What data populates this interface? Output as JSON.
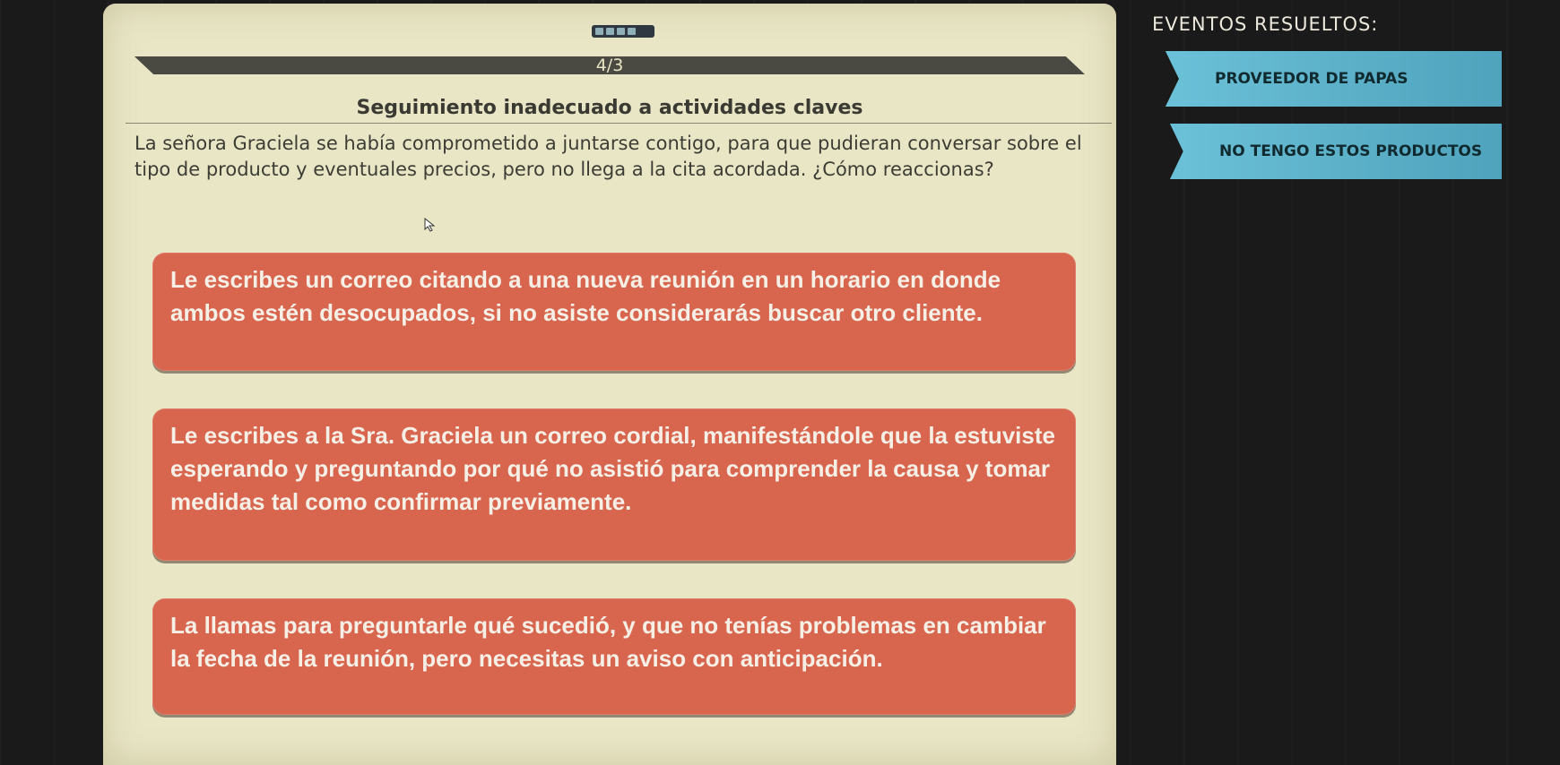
{
  "game": {
    "counter": "4/3",
    "title": "Seguimiento inadecuado a actividades claves",
    "scenario": "La señora Graciela se había comprometido a juntarse contigo, para que pudieran conversar sobre el tipo de producto y eventuales precios, pero no llega a la cita acordada. ¿Cómo reaccionas?",
    "options": [
      {
        "label": "Le escribes un correo citando a una nueva reunión en un horario en donde ambos estén desocupados, si no asiste considerarás buscar otro cliente."
      },
      {
        "label": "Le escribes a la Sra. Graciela un correo cordial, manifestándole que la estuviste esperando y preguntando por qué no asistió para comprender la causa y tomar medidas tal como confirmar previamente."
      },
      {
        "label": "La llamas para preguntarle qué sucedió, y que no tenías problemas en cambiar la fecha de la reunión, pero necesitas un aviso con anticipación."
      }
    ],
    "progress_icon": "progress-dots-icon",
    "cursor_icon": "mouse-pointer-icon"
  },
  "sidebar": {
    "title": "EVENTOS RESUELTOS:",
    "events": [
      {
        "label": "PROVEEDOR DE PAPAS"
      },
      {
        "label": "NO TENGO ESTOS PRODUCTOS"
      }
    ]
  },
  "colors": {
    "card_bg": "#e9e6c6",
    "option_bg": "#d8654e",
    "event_bg": "#5fb3cc",
    "page_bg": "#1a1a1a"
  }
}
